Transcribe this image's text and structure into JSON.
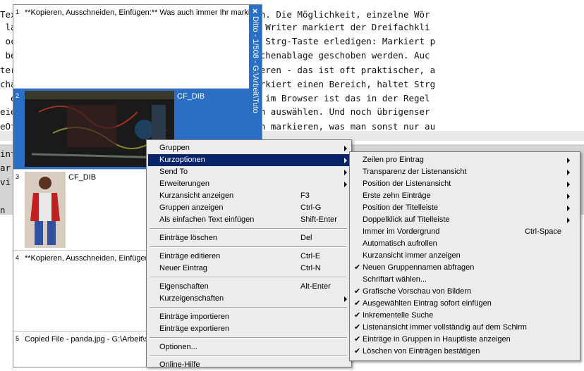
{
  "background_editor": {
    "lines": [
      "Tex                            Maustaste markieren. Die Möglichkeit, einzelne Wör",
      " la                            en wie LibreOffice Writer markiert der Dreifachkli",
      " oc                            das mit gedrückter Strg-Taste erledigen: Markiert p",
      " be                            Strg+C in die Zwischenablage geschoben werden. Auc",
      "ter                            n Bereich zu markieren - das ist oft praktischer, a",
      "cha                            ch kombinieren: Markiert einen Bereich, haltet Strg",
      "  e                            eren überall, aber im Browser ist das in der Regel",
      "eie                            Shift-Kombinationen auswählen. Und noch übrigenser",
      "eOf                            ch einzelne Spalten markieren, was man sonst nur au"
    ],
    "lower_lines": [
      "inf                                                 ",
      "ar                                                  ",
      "vi                                                  ",
      "                                                    ",
      "n                                                   "
    ]
  },
  "ditto": {
    "title": "Ditto - 1/508 - G:\\Arbeit\\Tuto",
    "close_label": "×",
    "entries": [
      {
        "num": "1",
        "text": "**Kopieren, Ausschneiden, Einfügen:** Was auch immer Ihr markier"
      },
      {
        "num": "2",
        "text": "CF_DIB"
      },
      {
        "num": "3",
        "text": "CF_DIB"
      },
      {
        "num": "4",
        "text": "**Kopieren, Ausschneiden, Einfüger"
      },
      {
        "num": "5",
        "text": "Copied File - panda.jpg - G:\\Arbeit\\s"
      }
    ]
  },
  "context_menu": {
    "items": [
      {
        "label": "Gruppen",
        "shortcut": "",
        "submenu": true
      },
      {
        "label": "Kurzoptionen",
        "shortcut": "",
        "submenu": true,
        "highlighted": true
      },
      {
        "label": "Send To",
        "shortcut": "",
        "submenu": true
      },
      {
        "label": "Erweiterungen",
        "shortcut": "",
        "submenu": true
      },
      {
        "label": "Kurzansicht anzeigen",
        "shortcut": "F3"
      },
      {
        "label": "Gruppen anzeigen",
        "shortcut": "Ctrl-G"
      },
      {
        "label": "Als einfachen Text einfügen",
        "shortcut": "Shift-Enter"
      },
      {
        "label": "Einträge löschen",
        "shortcut": "Del"
      },
      {
        "label": "Einträge editieren",
        "shortcut": "Ctrl-E"
      },
      {
        "label": "Neuer Eintrag",
        "shortcut": "Ctrl-N"
      },
      {
        "label": "Eigenschaften",
        "shortcut": "Alt-Enter"
      },
      {
        "label": "Kurzeigenschaften",
        "shortcut": "",
        "submenu": true
      },
      {
        "label": "Einträge importieren",
        "shortcut": ""
      },
      {
        "label": "Einträge exportieren",
        "shortcut": ""
      },
      {
        "label": "Optionen...",
        "shortcut": ""
      },
      {
        "label": "Online-Hilfe",
        "shortcut": ""
      }
    ]
  },
  "submenu": {
    "items": [
      {
        "label": "Zeilen pro Eintrag",
        "submenu": true,
        "checked": false,
        "shortcut": ""
      },
      {
        "label": "Transparenz der Listenansicht",
        "submenu": true,
        "checked": false,
        "shortcut": ""
      },
      {
        "label": "Position der Listenansicht",
        "submenu": true,
        "checked": false,
        "shortcut": ""
      },
      {
        "label": "Erste zehn Einträge",
        "submenu": true,
        "checked": false,
        "shortcut": ""
      },
      {
        "label": "Position der Titelleiste",
        "submenu": true,
        "checked": false,
        "shortcut": ""
      },
      {
        "label": "Doppelklick auf Titelleiste",
        "submenu": true,
        "checked": false,
        "shortcut": ""
      },
      {
        "label": "Immer im Vordergrund",
        "submenu": false,
        "checked": false,
        "shortcut": "Ctrl-Space"
      },
      {
        "label": "Automatisch aufrollen",
        "submenu": false,
        "checked": false,
        "shortcut": ""
      },
      {
        "label": "Kurzansicht immer anzeigen",
        "submenu": false,
        "checked": false,
        "shortcut": ""
      },
      {
        "label": "Neuen Gruppennamen abfragen",
        "submenu": false,
        "checked": true,
        "shortcut": ""
      },
      {
        "label": "Schriftart wählen...",
        "submenu": false,
        "checked": false,
        "shortcut": ""
      },
      {
        "label": "Grafische Vorschau von Bildern",
        "submenu": false,
        "checked": true,
        "shortcut": ""
      },
      {
        "label": "Ausgewählten Eintrag sofort einfügen",
        "submenu": false,
        "checked": true,
        "shortcut": ""
      },
      {
        "label": "Inkrementelle Suche",
        "submenu": false,
        "checked": true,
        "shortcut": ""
      },
      {
        "label": "Listenansicht immer vollständig auf dem Schirm",
        "submenu": false,
        "checked": true,
        "shortcut": ""
      },
      {
        "label": "Einträge in Gruppen in Hauptliste anzeigen",
        "submenu": false,
        "checked": true,
        "shortcut": ""
      },
      {
        "label": "Löschen von Einträgen bestätigen",
        "submenu": false,
        "checked": true,
        "shortcut": ""
      }
    ],
    "check_glyph": "✔"
  },
  "colors": {
    "ditto_accent": "#2b6fc4",
    "menu_highlight": "#0a246a",
    "menu_bg": "#ececec"
  }
}
